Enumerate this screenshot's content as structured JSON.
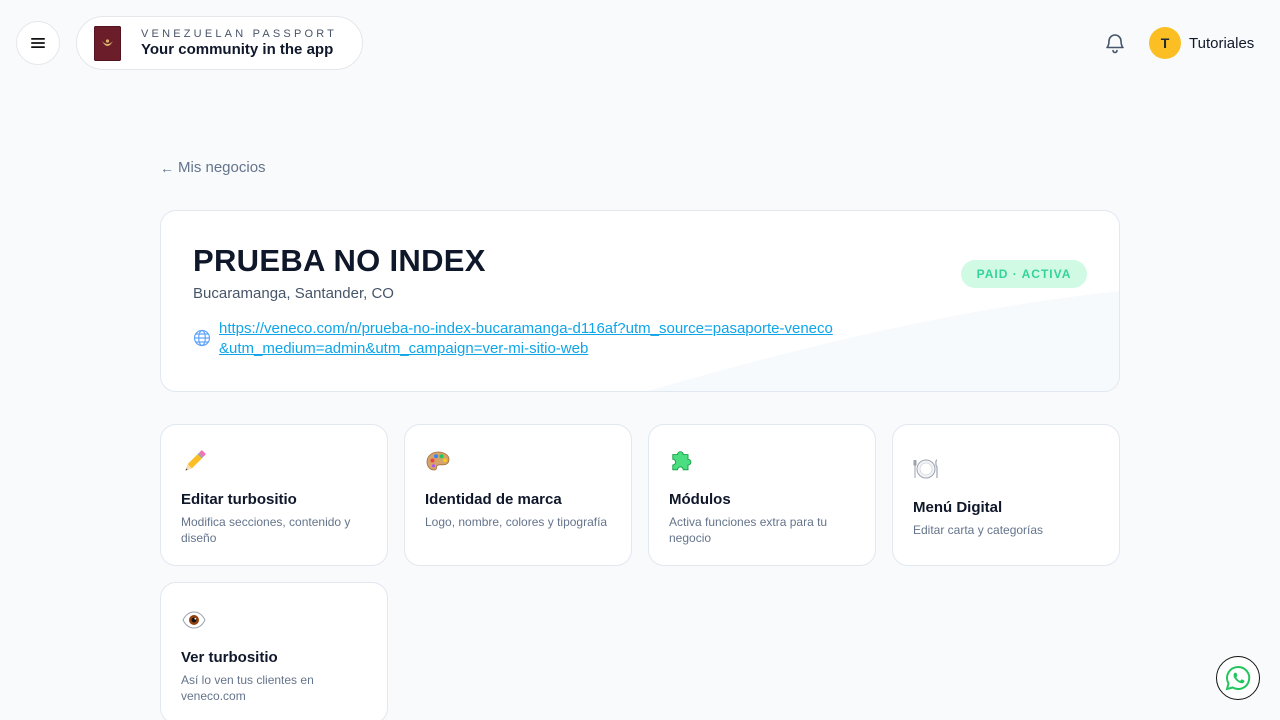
{
  "header": {
    "brand_kicker": "VENEZUELAN PASSPORT",
    "brand_title": "Your community in the app",
    "user_initial": "T",
    "user_name": "Tutoriales"
  },
  "nav": {
    "back_label": "Mis negocios"
  },
  "business": {
    "name": "PRUEBA NO INDEX",
    "location": "Bucaramanga, Santander, CO",
    "url": "https://veneco.com/n/prueba-no-index-bucaramanga-d116af?utm_source=pasaporte-veneco&utm_medium=admin&utm_campaign=ver-mi-sitio-web",
    "status": "PAID · ACTIVA"
  },
  "tiles": [
    {
      "title": "Editar turbositio",
      "desc": "Modifica secciones, contenido y diseño",
      "icon": "pencil-icon"
    },
    {
      "title": "Identidad de marca",
      "desc": "Logo, nombre, colores y tipografía",
      "icon": "palette-icon"
    },
    {
      "title": "Módulos",
      "desc": "Activa funciones extra para tu negocio",
      "icon": "puzzle-icon"
    },
    {
      "title": "Menú Digital",
      "desc": "Editar carta y categorías",
      "icon": "plate-icon"
    },
    {
      "title": "Ver turbositio",
      "desc": "Así lo ven tus clientes en veneco.com",
      "icon": "eye-icon"
    }
  ],
  "colors": {
    "accent_link": "#0ea5e9",
    "badge_bg": "#d1fae5",
    "badge_text": "#34d399",
    "avatar": "#fbbf24"
  }
}
